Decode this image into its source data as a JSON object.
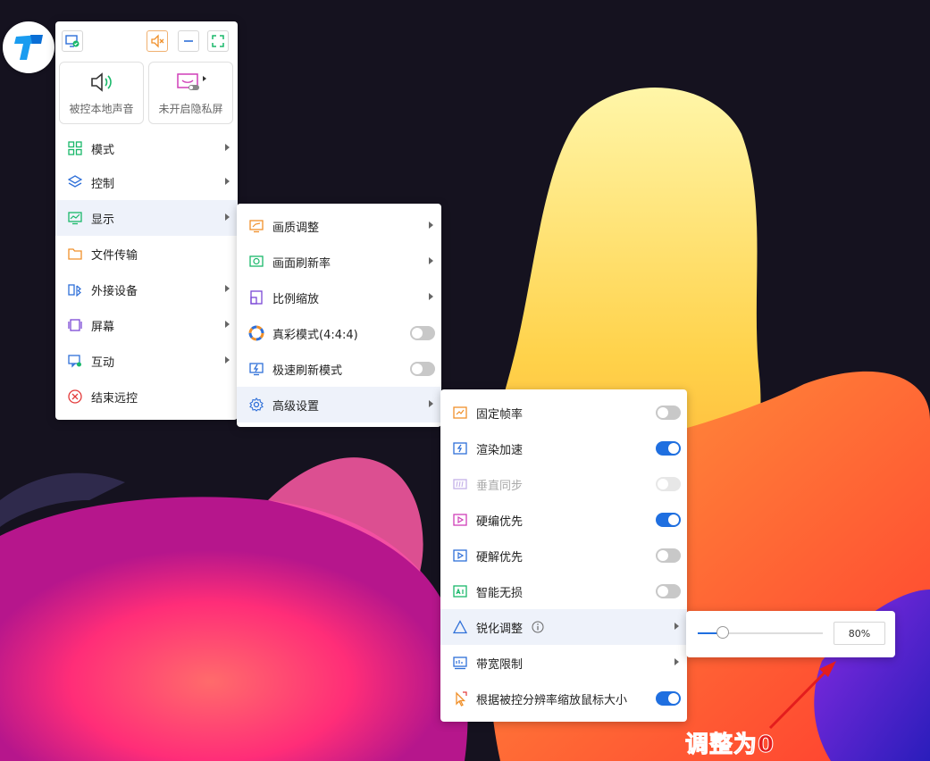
{
  "toolbar": {
    "local_sound_label": "被控本地声音",
    "privacy_label": "未开启隐私屏"
  },
  "main_menu": {
    "items": [
      {
        "label": "模式"
      },
      {
        "label": "控制"
      },
      {
        "label": "显示"
      },
      {
        "label": "文件传输"
      },
      {
        "label": "外接设备"
      },
      {
        "label": "屏幕"
      },
      {
        "label": "互动"
      },
      {
        "label": "结束远控"
      }
    ]
  },
  "display_menu": {
    "items": [
      {
        "label": "画质调整"
      },
      {
        "label": "画面刷新率"
      },
      {
        "label": "比例缩放"
      },
      {
        "label": "真彩模式(4:4:4)",
        "toggle": false
      },
      {
        "label": "极速刷新模式",
        "toggle": false
      },
      {
        "label": "高级设置"
      }
    ]
  },
  "advanced_menu": {
    "items": [
      {
        "label": "固定帧率",
        "toggle": false
      },
      {
        "label": "渲染加速",
        "toggle": true
      },
      {
        "label": "垂直同步",
        "toggle": false,
        "disabled": true
      },
      {
        "label": "硬编优先",
        "toggle": true
      },
      {
        "label": "硬解优先",
        "toggle": false
      },
      {
        "label": "智能无损",
        "toggle": false
      },
      {
        "label": "锐化调整"
      },
      {
        "label": "带宽限制"
      },
      {
        "label": "根据被控分辨率缩放鼠标大小",
        "toggle": true
      }
    ]
  },
  "sharpen": {
    "value": 0.2,
    "value_text": "80%"
  },
  "annotation": {
    "text": "调整为0"
  },
  "colors": {
    "accent": "#1f6fe0",
    "annotation": "#e41d1d"
  }
}
